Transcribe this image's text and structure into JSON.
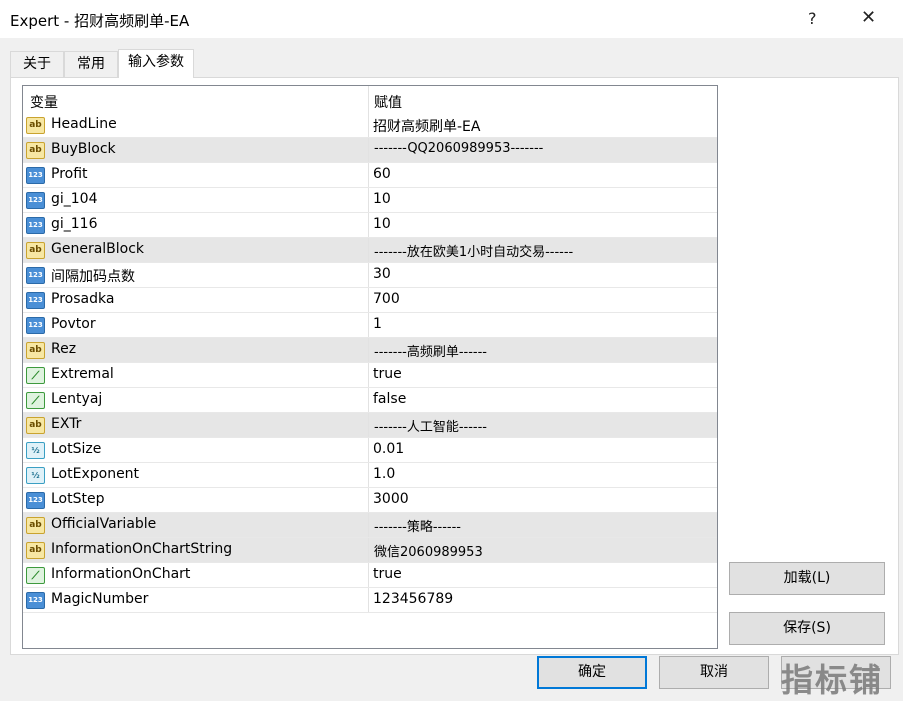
{
  "window": {
    "title": "Expert - 招财高频刷单-EA",
    "help_label": "?",
    "close_label": "✕"
  },
  "tabs": [
    {
      "label": "关于"
    },
    {
      "label": "常用"
    },
    {
      "label": "输入参数"
    }
  ],
  "grid": {
    "col_variable": "变量",
    "col_value": "赋值",
    "rows": [
      {
        "icon": "ab",
        "name": "HeadLine",
        "value": "招财高频刷单-EA"
      },
      {
        "icon": "ab",
        "name": "BuyBlock",
        "value": "-------QQ2060989953-------"
      },
      {
        "icon": "123",
        "name": "Profit",
        "value": "60"
      },
      {
        "icon": "123",
        "name": "gi_104",
        "value": "10"
      },
      {
        "icon": "123",
        "name": "gi_116",
        "value": "10"
      },
      {
        "icon": "ab",
        "name": "GeneralBlock",
        "value": "-------放在欧美1小时自动交易------"
      },
      {
        "icon": "123",
        "name": "间隔加码点数",
        "value": "30"
      },
      {
        "icon": "123",
        "name": "Prosadka",
        "value": "700"
      },
      {
        "icon": "123",
        "name": "Povtor",
        "value": "1"
      },
      {
        "icon": "ab",
        "name": "Rez",
        "value": "-------高频刷单------"
      },
      {
        "icon": "bool",
        "name": "Extremal",
        "value": "true"
      },
      {
        "icon": "bool",
        "name": "Lentyaj",
        "value": "false"
      },
      {
        "icon": "ab",
        "name": "EXTr",
        "value": "-------人工智能------"
      },
      {
        "icon": "half",
        "name": "LotSize",
        "value": "0.01"
      },
      {
        "icon": "half",
        "name": "LotExponent",
        "value": "1.0"
      },
      {
        "icon": "123",
        "name": "LotStep",
        "value": "3000"
      },
      {
        "icon": "ab",
        "name": "OfficialVariable",
        "value": "-------策略------"
      },
      {
        "icon": "ab",
        "name": "InformationOnChartString",
        "value": "微信2060989953"
      },
      {
        "icon": "bool",
        "name": "InformationOnChart",
        "value": "true"
      },
      {
        "icon": "123",
        "name": "MagicNumber",
        "value": "123456789"
      }
    ]
  },
  "icon_glyphs": {
    "ab": "ab",
    "123": "123",
    "bool": "⟋",
    "half": "½"
  },
  "buttons": {
    "load": "加载(L)",
    "save": "保存(S)",
    "ok": "确定",
    "cancel": "取消"
  },
  "watermark": "指标铺"
}
